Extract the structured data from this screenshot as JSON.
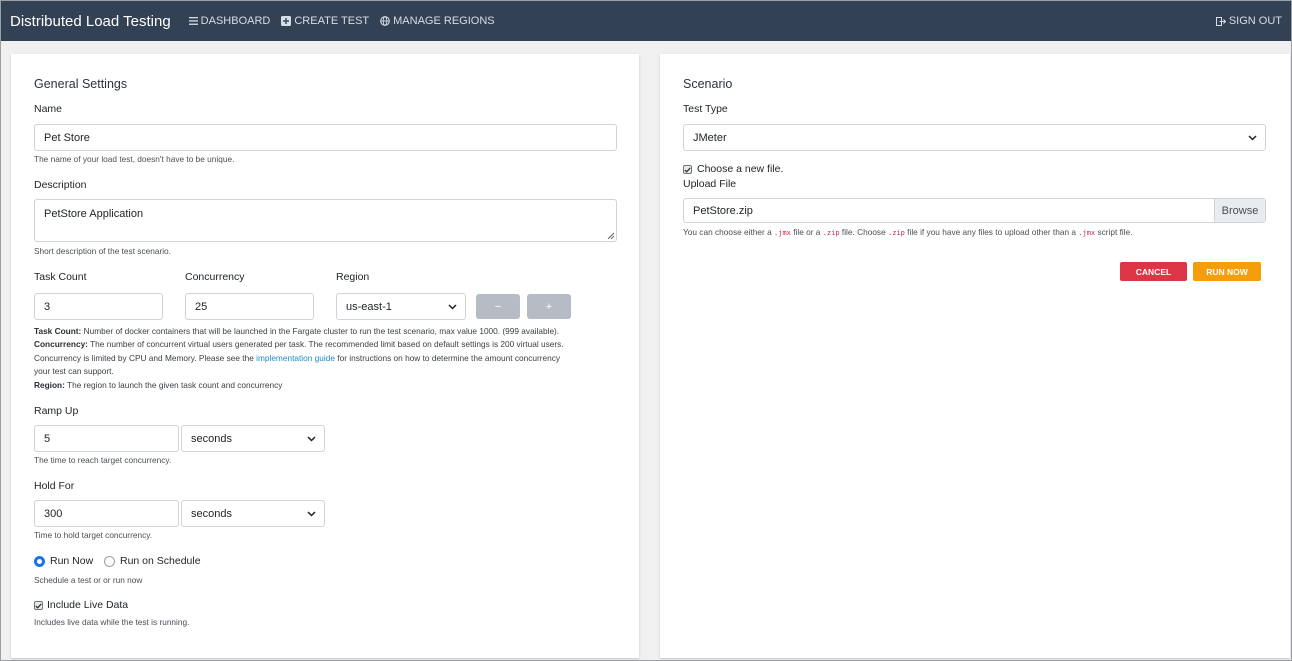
{
  "nav": {
    "brand": "Distributed Load Testing",
    "links": [
      "DASHBOARD",
      "CREATE TEST",
      "MANAGE REGIONS"
    ],
    "sign_out": "SIGN OUT"
  },
  "general": {
    "title": "General Settings",
    "name": {
      "label": "Name",
      "value": "Pet Store",
      "help": "The name of your load test, doesn't have to be unique."
    },
    "description": {
      "label": "Description",
      "value": "PetStore Application",
      "help": "Short description of the test scenario."
    },
    "task_count": {
      "label": "Task Count",
      "value": "3"
    },
    "concurrency": {
      "label": "Concurrency",
      "value": "25"
    },
    "region": {
      "label": "Region",
      "value": "us-east-1"
    },
    "minus_label": "−",
    "plus_label": "+",
    "info": {
      "task_count_label": "Task Count:",
      "task_count_text": " Number of docker containers that will be launched in the Fargate cluster to run the test scenario, max value 1000. (999 available).",
      "concurrency_label": "Concurrency:",
      "concurrency_text": " The number of concurrent virtual users generated per task. The recommended limit based on default settings is 200 virtual users.",
      "concurrency_text2": "Concurrency is limited by CPU and Memory. Please see the ",
      "guide_link": "implementation guide",
      "concurrency_text3": " for instructions on how to determine the amount concurrency",
      "concurrency_text4": "your test can support.",
      "region_label": "Region:",
      "region_text": " The region to launch the given task count and concurrency"
    },
    "ramp_up": {
      "label": "Ramp Up",
      "value": "5",
      "unit": "seconds",
      "help": "The time to reach target concurrency."
    },
    "hold_for": {
      "label": "Hold For",
      "value": "300",
      "unit": "seconds",
      "help": "Time to hold target concurrency."
    },
    "schedule": {
      "run_now": "Run Now",
      "run_on_schedule": "Run on Schedule",
      "help": "Schedule a test or or run now",
      "selected": "run_now"
    },
    "live_data": {
      "label": "Include Live Data",
      "help": "Includes live data while the test is running.",
      "checked": true
    }
  },
  "scenario": {
    "title": "Scenario",
    "test_type": {
      "label": "Test Type",
      "value": "JMeter"
    },
    "new_file": {
      "label": "Choose a new file.",
      "checked": true
    },
    "upload": {
      "label": "Upload File",
      "value": "PetStore.zip",
      "browse": "Browse"
    },
    "upload_help": {
      "t1": "You can choose either a ",
      "c1": ".jmx",
      "t2": " file or a ",
      "c2": ".zip",
      "t3": " file. Choose ",
      "c3": ".zip",
      "t4": " file if you have any files to upload other than a ",
      "c4": ".jmx",
      "t5": " script file."
    },
    "cancel": "CANCEL",
    "run_now": "RUN NOW"
  },
  "colors": {
    "navbar": "#334155",
    "accent": "#1a73e8",
    "cancel": "#dc3545",
    "run": "#f59e0b",
    "link": "#1f8dc4"
  }
}
